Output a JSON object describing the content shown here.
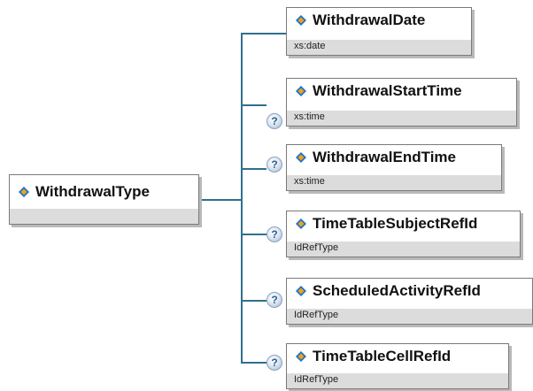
{
  "root": {
    "name": "WithdrawalType",
    "type": ""
  },
  "elements": [
    {
      "name": "WithdrawalDate",
      "type": "xs:date",
      "optional": false
    },
    {
      "name": "WithdrawalStartTime",
      "type": "xs:time",
      "optional": true,
      "optional_mark": "?"
    },
    {
      "name": "WithdrawalEndTime",
      "type": "xs:time",
      "optional": true,
      "optional_mark": "?"
    },
    {
      "name": "TimeTableSubjectRefId",
      "type": "IdRefType",
      "optional": true,
      "optional_mark": "?"
    },
    {
      "name": "ScheduledActivityRefId",
      "type": "IdRefType",
      "optional": true,
      "optional_mark": "?"
    },
    {
      "name": "TimeTableCellRefId",
      "type": "IdRefType",
      "optional": true,
      "optional_mark": "?"
    }
  ],
  "colors": {
    "connector": "#2f6f8f",
    "icon_blue": "#1e73c8",
    "icon_orange": "#f0a11b",
    "type_band": "#dcdcdc"
  },
  "icons": {
    "element": "element-diamond-icon",
    "optional": "question-mark-icon"
  }
}
